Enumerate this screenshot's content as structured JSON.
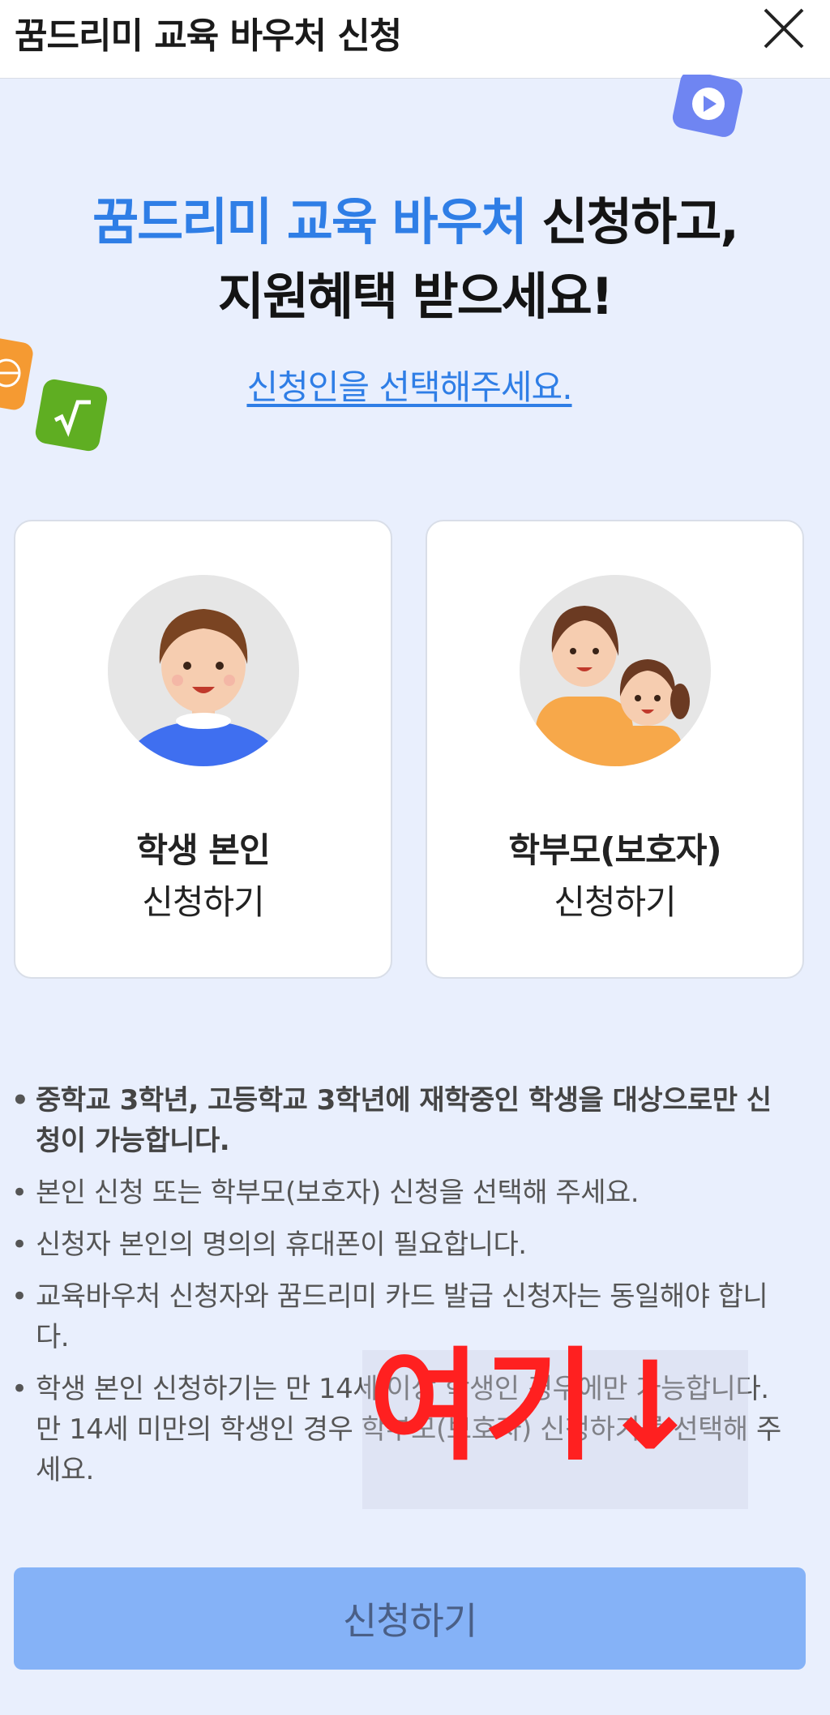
{
  "header": {
    "title": "꿈드리미 교육 바우처 신청",
    "close_icon": "close-icon"
  },
  "hero": {
    "headline_highlight": "꿈드리미 교육 바우처",
    "headline_rest": " 신청하고,",
    "headline_line2": "지원혜택 받으세요!",
    "select_prompt": "신청인을 선택해주세요.",
    "accent_color": "#2f7ee6"
  },
  "cards": [
    {
      "line1": "학생 본인",
      "line2": "신청하기",
      "avatar_icon": "student-avatar-icon"
    },
    {
      "line1": "학부모(보호자)",
      "line2": "신청하기",
      "avatar_icon": "parent-child-avatar-icon"
    }
  ],
  "notes": [
    "중학교 3학년, 고등학교 3학년에 재학중인 학생을 대상으로만 신청이 가능합니다.",
    "본인 신청 또는 학부모(보호자) 신청을 선택해 주세요.",
    "신청자 본인의 명의의 휴대폰이 필요합니다.",
    "교육바우처 신청자와 꿈드리미 카드 발급 신청자는 동일해야 합니다.",
    "학생 본인 신청하기는 만 14세 이상 학생인 경우에만 가능합니다. 만 14세 미만의 학생인 경우 학부모(보호자) 신청하기를 선택해 주세요."
  ],
  "annotation": {
    "text": "여기↓",
    "color": "#ff2020"
  },
  "footer": {
    "submit_label": "신청하기",
    "submit_color": "#85b2f7"
  }
}
